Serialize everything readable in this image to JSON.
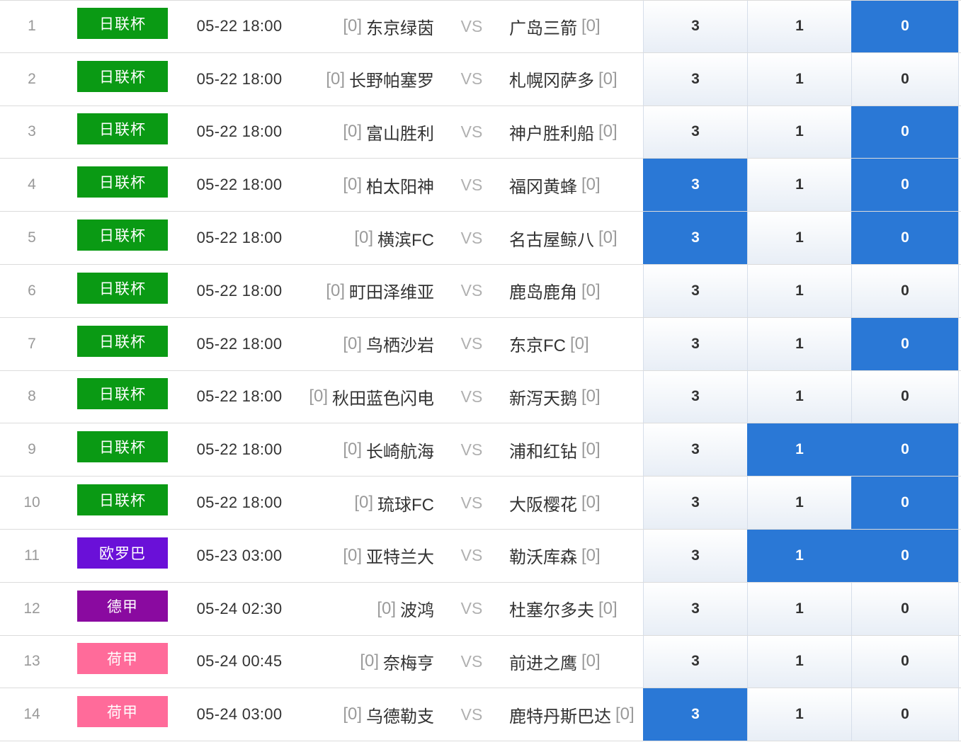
{
  "league_colors": {
    "日联杯": "#0a9a14",
    "欧罗巴": "#6a10d8",
    "德甲": "#8a0aa0",
    "荷甲": "#ff6b9a"
  },
  "selected_color": "#2a78d6",
  "vs_label": "VS",
  "matches": [
    {
      "idx": "1",
      "league": "日联杯",
      "time": "05-22 18:00",
      "home_rank": "[0]",
      "home": "东京绿茵",
      "away": "广岛三箭",
      "away_rank": "[0]",
      "odds": [
        "3",
        "1",
        "0"
      ],
      "selected": [
        false,
        false,
        true
      ]
    },
    {
      "idx": "2",
      "league": "日联杯",
      "time": "05-22 18:00",
      "home_rank": "[0]",
      "home": "长野帕塞罗",
      "away": "札幌冈萨多",
      "away_rank": "[0]",
      "odds": [
        "3",
        "1",
        "0"
      ],
      "selected": [
        false,
        false,
        false
      ]
    },
    {
      "idx": "3",
      "league": "日联杯",
      "time": "05-22 18:00",
      "home_rank": "[0]",
      "home": "富山胜利",
      "away": "神户胜利船",
      "away_rank": "[0]",
      "odds": [
        "3",
        "1",
        "0"
      ],
      "selected": [
        false,
        false,
        true
      ]
    },
    {
      "idx": "4",
      "league": "日联杯",
      "time": "05-22 18:00",
      "home_rank": "[0]",
      "home": "柏太阳神",
      "away": "福冈黄蜂",
      "away_rank": "[0]",
      "odds": [
        "3",
        "1",
        "0"
      ],
      "selected": [
        true,
        false,
        true
      ]
    },
    {
      "idx": "5",
      "league": "日联杯",
      "time": "05-22 18:00",
      "home_rank": "[0]",
      "home": "横滨FC",
      "away": "名古屋鲸八",
      "away_rank": "[0]",
      "odds": [
        "3",
        "1",
        "0"
      ],
      "selected": [
        true,
        false,
        true
      ]
    },
    {
      "idx": "6",
      "league": "日联杯",
      "time": "05-22 18:00",
      "home_rank": "[0]",
      "home": "町田泽维亚",
      "away": "鹿岛鹿角",
      "away_rank": "[0]",
      "odds": [
        "3",
        "1",
        "0"
      ],
      "selected": [
        false,
        false,
        false
      ]
    },
    {
      "idx": "7",
      "league": "日联杯",
      "time": "05-22 18:00",
      "home_rank": "[0]",
      "home": "鸟栖沙岩",
      "away": "东京FC",
      "away_rank": "[0]",
      "odds": [
        "3",
        "1",
        "0"
      ],
      "selected": [
        false,
        false,
        true
      ]
    },
    {
      "idx": "8",
      "league": "日联杯",
      "time": "05-22 18:00",
      "home_rank": "[0]",
      "home": "秋田蓝色闪电",
      "away": "新泻天鹅",
      "away_rank": "[0]",
      "odds": [
        "3",
        "1",
        "0"
      ],
      "selected": [
        false,
        false,
        false
      ]
    },
    {
      "idx": "9",
      "league": "日联杯",
      "time": "05-22 18:00",
      "home_rank": "[0]",
      "home": "长崎航海",
      "away": "浦和红钻",
      "away_rank": "[0]",
      "odds": [
        "3",
        "1",
        "0"
      ],
      "selected": [
        false,
        true,
        true
      ]
    },
    {
      "idx": "10",
      "league": "日联杯",
      "time": "05-22 18:00",
      "home_rank": "[0]",
      "home": "琉球FC",
      "away": "大阪樱花",
      "away_rank": "[0]",
      "odds": [
        "3",
        "1",
        "0"
      ],
      "selected": [
        false,
        false,
        true
      ]
    },
    {
      "idx": "11",
      "league": "欧罗巴",
      "time": "05-23 03:00",
      "home_rank": "[0]",
      "home": "亚特兰大",
      "away": "勒沃库森",
      "away_rank": "[0]",
      "odds": [
        "3",
        "1",
        "0"
      ],
      "selected": [
        false,
        true,
        true
      ]
    },
    {
      "idx": "12",
      "league": "德甲",
      "time": "05-24 02:30",
      "home_rank": "[0]",
      "home": "波鸿",
      "away": "杜塞尔多夫",
      "away_rank": "[0]",
      "odds": [
        "3",
        "1",
        "0"
      ],
      "selected": [
        false,
        false,
        false
      ]
    },
    {
      "idx": "13",
      "league": "荷甲",
      "time": "05-24 00:45",
      "home_rank": "[0]",
      "home": "奈梅亨",
      "away": "前进之鹰",
      "away_rank": "[0]",
      "odds": [
        "3",
        "1",
        "0"
      ],
      "selected": [
        false,
        false,
        false
      ]
    },
    {
      "idx": "14",
      "league": "荷甲",
      "time": "05-24 03:00",
      "home_rank": "[0]",
      "home": "乌德勒支",
      "away": "鹿特丹斯巴达",
      "away_rank": "[0]",
      "odds": [
        "3",
        "1",
        "0"
      ],
      "selected": [
        true,
        false,
        false
      ]
    }
  ]
}
